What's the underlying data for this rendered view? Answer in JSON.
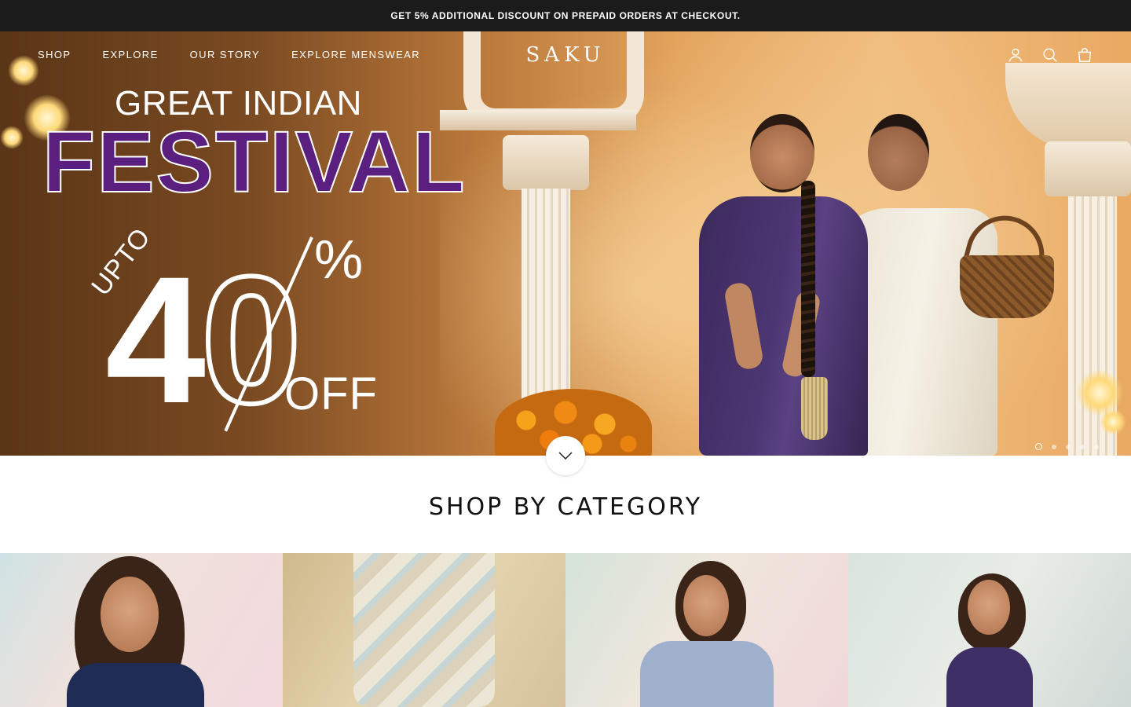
{
  "announcement": {
    "text": "GET 5% ADDITIONAL DISCOUNT ON PREPAID ORDERS AT CHECKOUT."
  },
  "header": {
    "nav": [
      {
        "label": "SHOP"
      },
      {
        "label": "EXPLORE"
      },
      {
        "label": "OUR STORY"
      },
      {
        "label": "EXPLORE MENSWEAR"
      }
    ],
    "logo": "SAKU",
    "icons": [
      "account-icon",
      "search-icon",
      "cart-icon"
    ]
  },
  "hero": {
    "line1": "GREAT INDIAN",
    "line2": "FESTIVAL",
    "upto": "UPTO",
    "discount_number": "4",
    "discount_zero": "0",
    "percent": "%",
    "off": "OFF",
    "slide_count": 5,
    "active_slide": 1,
    "colors": {
      "festival_text": "#5b1f7f"
    }
  },
  "category_section": {
    "title": "SHOP BY CATEGORY",
    "tiles": 4
  },
  "colors": {
    "announcement_bg": "#1b1b1b",
    "header_text": "#ffffff"
  }
}
